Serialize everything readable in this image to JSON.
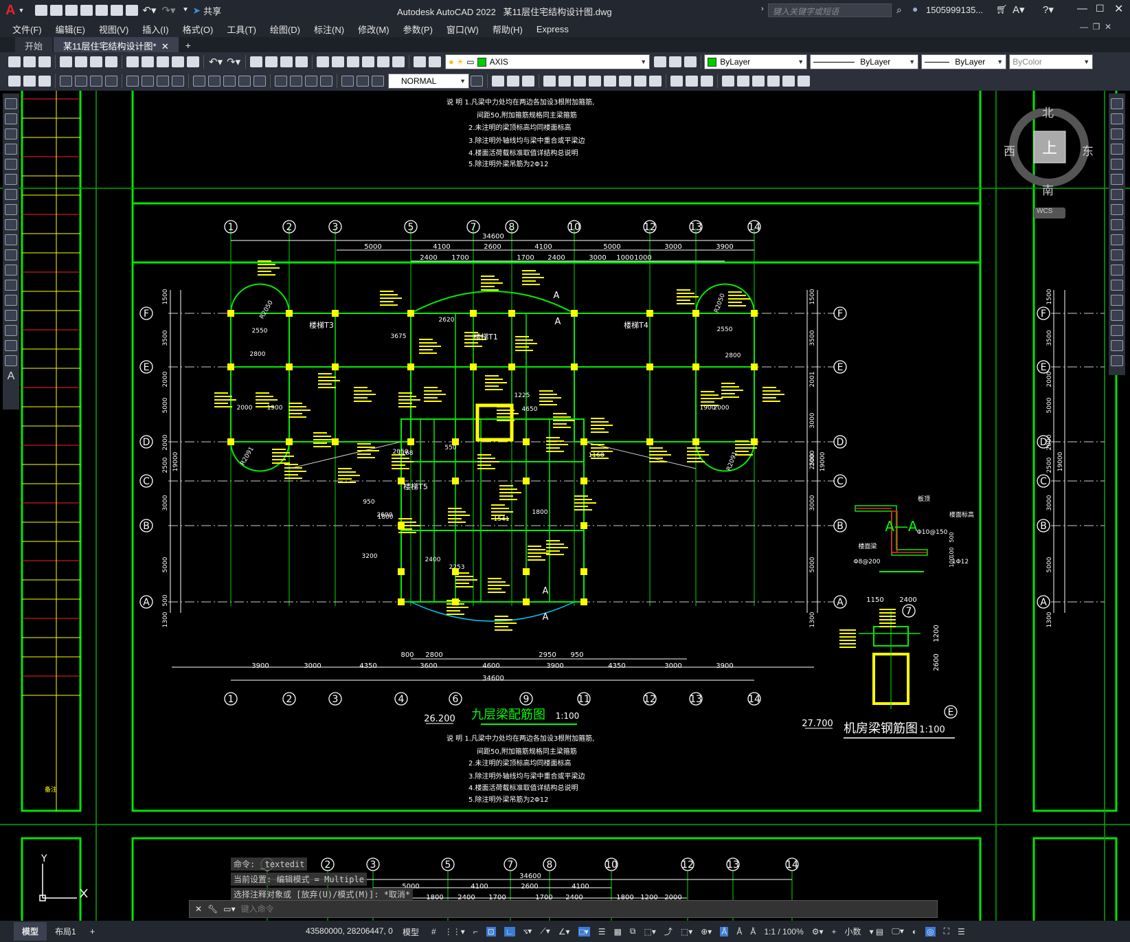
{
  "app": {
    "logo": "A",
    "title": "Autodesk AutoCAD 2022",
    "file": "某11层住宅结构设计图.dwg",
    "share": "共享",
    "search_placeholder": "键入关键字或短语",
    "user": "1505999135...",
    "window_controls": [
      "minimize",
      "maximize",
      "close"
    ]
  },
  "menu": [
    "文件(F)",
    "编辑(E)",
    "视图(V)",
    "插入(I)",
    "格式(O)",
    "工具(T)",
    "绘图(D)",
    "标注(N)",
    "修改(M)",
    "参数(P)",
    "窗口(W)",
    "帮助(H)",
    "Express"
  ],
  "tabs": [
    {
      "label": "开始"
    },
    {
      "label": "某11层住宅结构设计图*"
    }
  ],
  "toolbar": {
    "layer": "AXIS",
    "layer_color": "#00cc00",
    "color": "ByLayer",
    "linetype": "ByLayer",
    "lineweight": "ByLayer",
    "plotstyle": "ByColor",
    "dimstyle": "NORMAL"
  },
  "viewcube": {
    "north": "北",
    "south": "南",
    "east": "东",
    "west": "西",
    "top": "上",
    "wcs": "WCS"
  },
  "drawing": {
    "notes_top": [
      "说 明 1.凡梁中力处均在两边各加设3根附加箍筋,",
      "间距50,附加箍筋规格同主梁箍筋",
      "2.未注明的梁顶标高均同楼面标高",
      "3.除注明外轴线均与梁中重合或平梁边",
      "4.楼面活荷载标准取值详结构总说明",
      "5.除注明外梁吊筋为2Φ12"
    ],
    "axes_top": [
      "1",
      "2",
      "3",
      "5",
      "7",
      "8",
      "10",
      "12",
      "13",
      "14"
    ],
    "axes_bottom": [
      "1",
      "2",
      "3",
      "4",
      "6",
      "9",
      "11",
      "12",
      "13",
      "14"
    ],
    "axes_left": [
      "F",
      "E",
      "D",
      "C",
      "B",
      "A"
    ],
    "dims_top_total": "34600",
    "dims_top_row1": [
      "5000",
      "4100",
      "2600",
      "4100",
      "5000",
      "3000",
      "3900"
    ],
    "dims_top_row2": [
      "2400",
      "1700",
      "1700",
      "2400",
      "3000",
      "1000",
      "1000"
    ],
    "dims_bottom_row1": [
      "3900",
      "3000",
      "4350",
      "3600",
      "4600",
      "3900",
      "4350",
      "3000",
      "3900"
    ],
    "dims_bottom_row2": [
      "800",
      "2800",
      "2950",
      "950"
    ],
    "dims_bottom_total": "34600",
    "dims_left": [
      "1500",
      "3500",
      "2000",
      "5000",
      "2000",
      "2500",
      "3000",
      "5000",
      "500",
      "1300",
      "19000"
    ],
    "dims_right": [
      "1500",
      "3500",
      "2001",
      "3000",
      "2000",
      "2500",
      "3000",
      "5000",
      "1300",
      "19000"
    ],
    "stair_labels": [
      "楼梯T3",
      "楼梯T1",
      "楼梯T4",
      "楼梯T5"
    ],
    "section_marks": [
      "A",
      "A",
      "A",
      "A"
    ],
    "radius_labels": [
      "R2050",
      "R2091",
      "R2050",
      "R2091"
    ],
    "inner_dims": [
      "2800",
      "2550",
      "2000",
      "1900",
      "2620",
      "3675",
      "2253",
      "1800",
      "1541",
      "1225",
      "4650",
      "2600",
      "3200",
      "1800",
      "950",
      "2050",
      "1168",
      "1168",
      "550",
      "1900",
      "2000",
      "2800",
      "2550",
      "2400"
    ],
    "level_left": "26.200",
    "title_main": "九层梁配筋图",
    "scale_main": "1:100",
    "notes_bottom": [
      "说 明 1.凡梁中力处均在两边各加设3根附加箍筋,",
      "间距50,附加箍筋规格同主梁箍筋",
      "2.未注明的梁顶标高均同楼面标高",
      "3.除注明外轴线均与梁中重合或平梁边",
      "4.楼面活荷载标准取值详结构总说明",
      "5.除注明外梁吊筋为2Φ12"
    ],
    "section_aa": {
      "title": "A—A",
      "labels": [
        "板顶",
        "楼面标高",
        "楼面梁",
        "Φ8@200",
        "Φ10@150",
        "1Φ12"
      ],
      "dims": [
        "500",
        "100",
        "100"
      ]
    },
    "machine_room": {
      "level": "27.700",
      "title": "机房梁钢筋图",
      "scale": "1:100",
      "axis_top": "7",
      "axis_right": "E",
      "dims": [
        "1150",
        "2400",
        "1200",
        "2600"
      ]
    },
    "bottom_view": {
      "axes": [
        "1",
        "2",
        "3",
        "5",
        "7",
        "8",
        "10",
        "12",
        "13",
        "14"
      ],
      "total": "34600",
      "dims1": [
        "5000",
        "4100",
        "2600",
        "4100"
      ],
      "dims2": [
        "1800",
        "2400",
        "1700",
        "1700",
        "2400",
        "1800",
        "1200",
        "2000"
      ]
    },
    "right_partial": {
      "axes": [
        "F",
        "E",
        "D",
        "C",
        "B",
        "A"
      ],
      "dims": [
        "1500",
        "3500",
        "2000",
        "5000",
        "2000",
        "2500",
        "3000",
        "5000",
        "1300",
        "19000"
      ]
    }
  },
  "ucs": {
    "x": "X",
    "y": "Y"
  },
  "command": {
    "history": [
      "命令: _textedit",
      "当前设置: 编辑模式 = Multiple",
      "选择注释对象或 [放弃(U)/模式(M)]: *取消*"
    ],
    "placeholder": "键入命令"
  },
  "layout_tabs": [
    "模型",
    "布局1"
  ],
  "status": {
    "coords": "43580000, 28206447, 0",
    "space": "模型",
    "scale": "1:1 / 100%",
    "units": "小数"
  }
}
